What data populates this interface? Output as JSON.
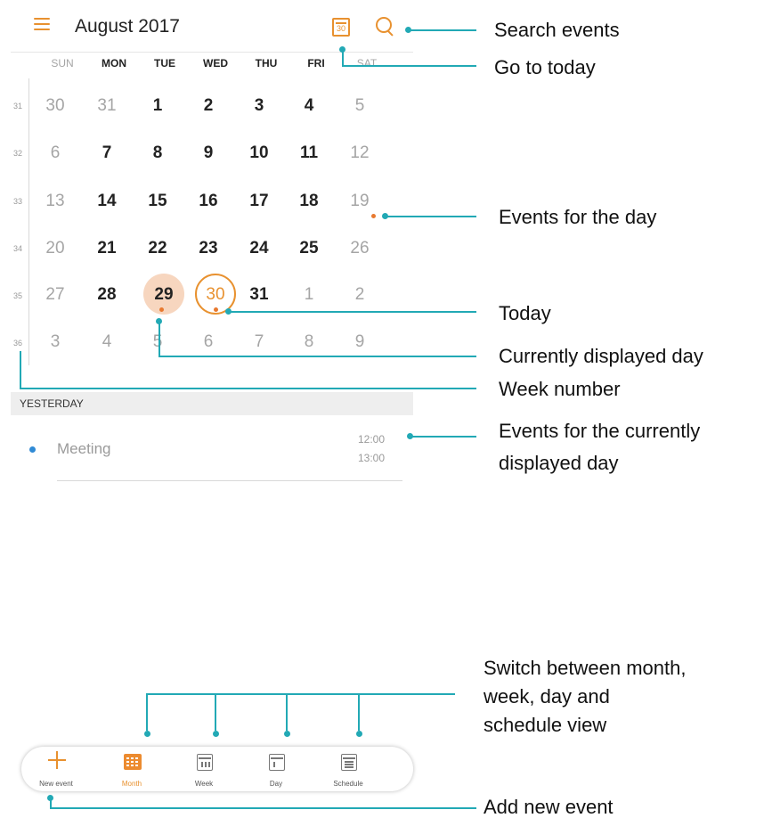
{
  "header": {
    "month_title": "August 2017",
    "today_icon_day": "30"
  },
  "weekdays": [
    "SUN",
    "MON",
    "TUE",
    "WED",
    "THU",
    "FRI",
    "SAT"
  ],
  "weeks": [
    {
      "number": "31",
      "days": [
        "30",
        "31",
        "1",
        "2",
        "3",
        "4",
        "5"
      ]
    },
    {
      "number": "32",
      "days": [
        "6",
        "7",
        "8",
        "9",
        "10",
        "11",
        "12"
      ]
    },
    {
      "number": "33",
      "days": [
        "13",
        "14",
        "15",
        "16",
        "17",
        "18",
        "19"
      ]
    },
    {
      "number": "34",
      "days": [
        "20",
        "21",
        "22",
        "23",
        "24",
        "25",
        "26"
      ]
    },
    {
      "number": "35",
      "days": [
        "27",
        "28",
        "29",
        "30",
        "31",
        "1",
        "2"
      ]
    },
    {
      "number": "36",
      "days": [
        "3",
        "4",
        "5",
        "6",
        "7",
        "8",
        "9"
      ]
    }
  ],
  "today_date": "30",
  "selected_date": "29",
  "event_section": {
    "heading": "YESTERDAY",
    "events": [
      {
        "title": "Meeting",
        "start": "12:00",
        "end": "13:00",
        "color": "#2f8ad5"
      }
    ]
  },
  "bottom_bar": {
    "tabs": [
      {
        "label": "New event",
        "icon": "plus-icon"
      },
      {
        "label": "Month",
        "icon": "month-view-icon",
        "selected": true
      },
      {
        "label": "Week",
        "icon": "week-view-icon"
      },
      {
        "label": "Day",
        "icon": "day-view-icon"
      },
      {
        "label": "Schedule",
        "icon": "schedule-view-icon"
      }
    ]
  },
  "callouts": {
    "search_events": "Search events",
    "go_to_today": "Go to today",
    "events_for_day": "Events for the day",
    "today": "Today",
    "currently_displayed_day": "Currently displayed day",
    "week_number": "Week number",
    "events_current_day_line1": "Events for the currently",
    "events_current_day_line2": "displayed day",
    "switch_view_line1": "Switch between month,",
    "switch_view_line2": "week, day and",
    "switch_view_line3": "schedule view",
    "add_new_event": "Add new event"
  },
  "colors": {
    "accent": "#e8912f",
    "callout_line": "#22a9b5",
    "selected_day_bg": "#f7d6bf",
    "event_dot": "#2f8ad5"
  }
}
